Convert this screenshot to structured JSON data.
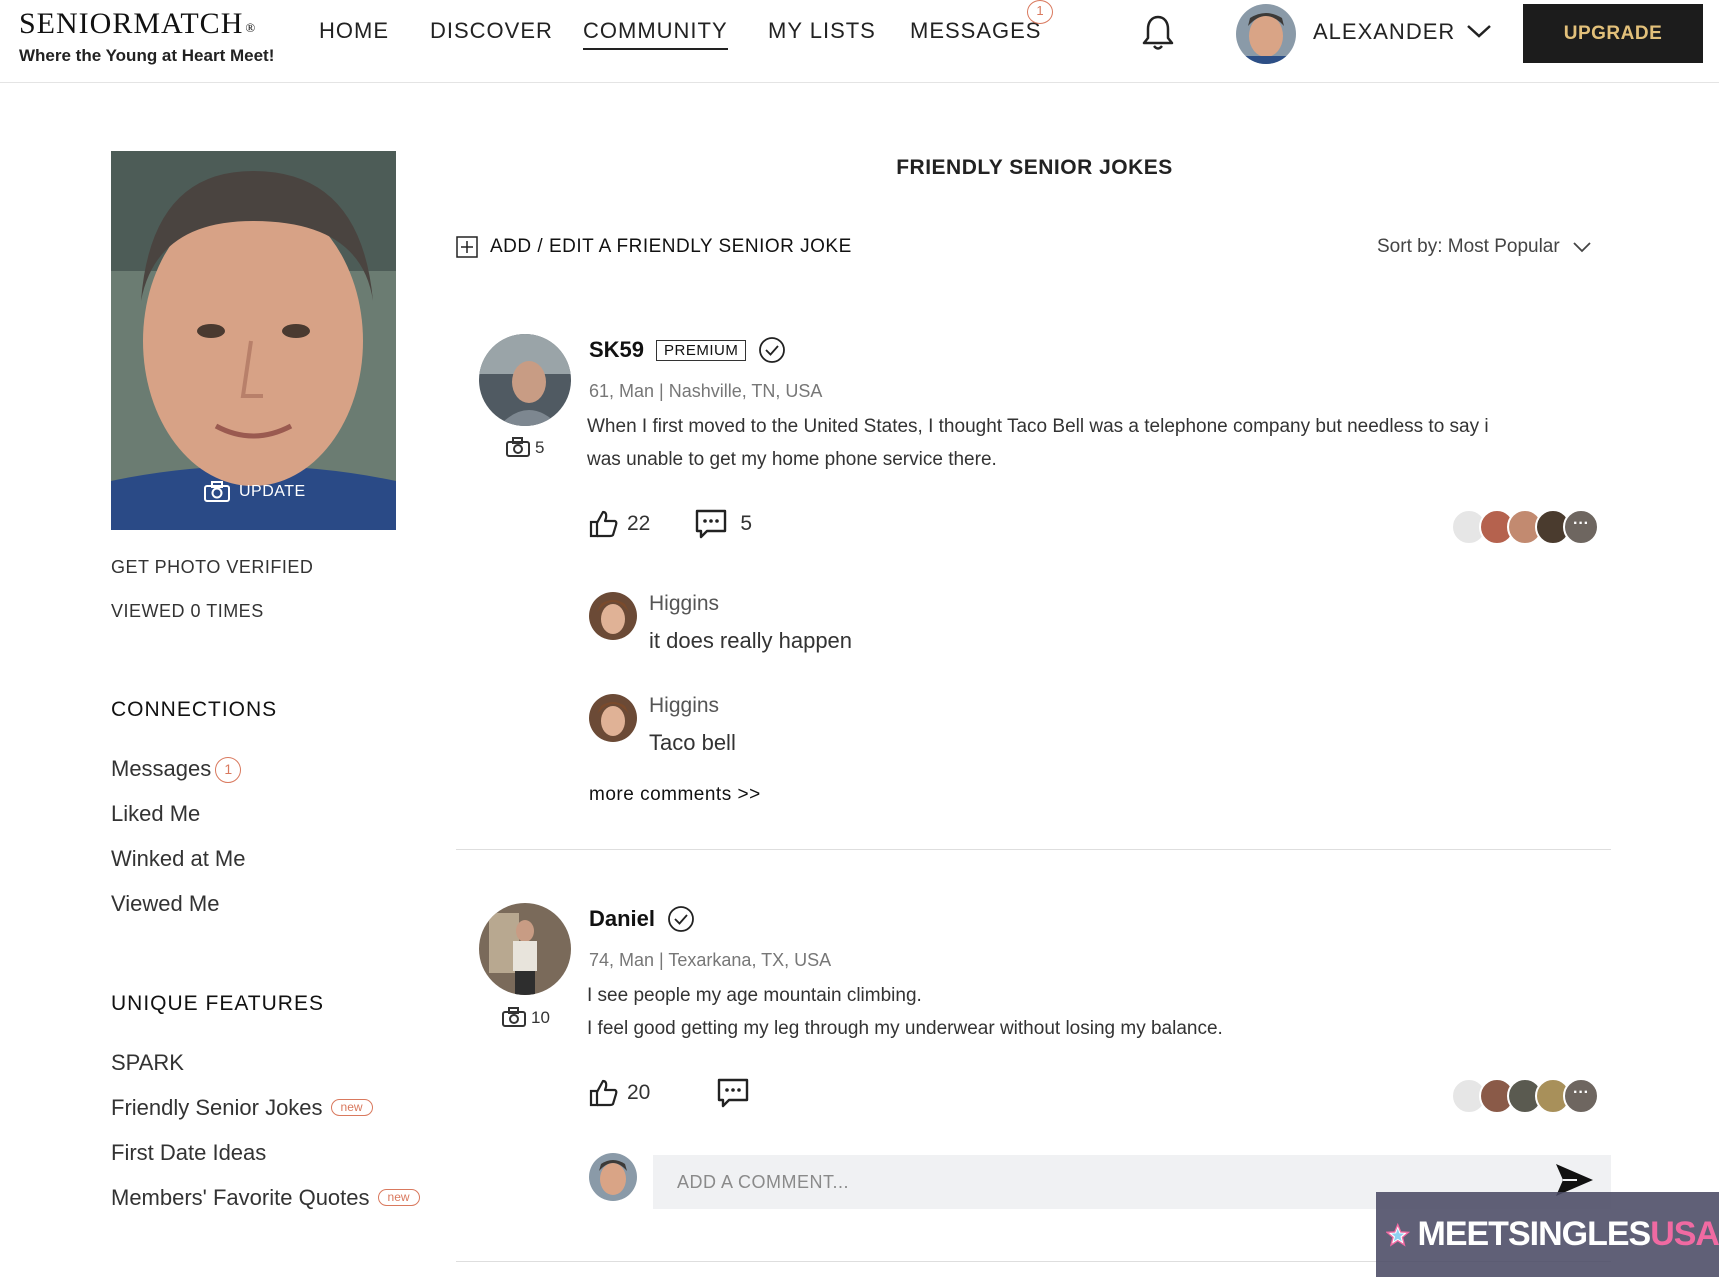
{
  "header": {
    "logo_title": "SENIORMATCH",
    "logo_mark": "®",
    "logo_tagline": "Where the Young at Heart Meet!",
    "nav": [
      "HOME",
      "DISCOVER",
      "COMMUNITY",
      "MY LISTS",
      "MESSAGES"
    ],
    "active_nav": "COMMUNITY",
    "messages_badge": "1",
    "user_name": "ALEXANDER",
    "upgrade_label": "UPGRADE",
    "icons": [
      "bell-icon",
      "chevron-down-icon"
    ]
  },
  "sidebar": {
    "photo_update_label": "UPDATE",
    "get_verified": "GET PHOTO VERIFIED",
    "viewed": "VIEWED 0 TIMES",
    "connections_heading": "CONNECTIONS",
    "connections": [
      {
        "label": "Messages",
        "badge": "1"
      },
      {
        "label": "Liked Me"
      },
      {
        "label": "Winked at Me"
      },
      {
        "label": "Viewed Me"
      }
    ],
    "features_heading": "UNIQUE FEATURES",
    "features": [
      {
        "label": "SPARK"
      },
      {
        "label": "Friendly Senior Jokes",
        "tag": "new"
      },
      {
        "label": "First Date Ideas"
      },
      {
        "label": "Members' Favorite Quotes",
        "tag": "new"
      }
    ]
  },
  "main": {
    "title": "FRIENDLY SENIOR JOKES",
    "add_label": "ADD / EDIT A FRIENDLY SENIOR JOKE",
    "sort_label": "Sort by: Most Popular",
    "posts": [
      {
        "name": "SK59",
        "badge": "PREMIUM",
        "verified": true,
        "photos": "5",
        "meta": "61, Man | Nashville, TN, USA",
        "text_lines": [
          "When I first moved to the United States, I thought Taco Bell was a telephone company but needless to say i",
          "was unable to get my home phone service there."
        ],
        "likes": "22",
        "comments_count": "5",
        "comments": [
          {
            "name": "Higgins",
            "text": "it does really happen"
          },
          {
            "name": "Higgins",
            "text": "Taco bell"
          }
        ],
        "more_comments": "more comments >>"
      },
      {
        "name": "Daniel",
        "verified": true,
        "photos": "10",
        "meta": "74, Man | Texarkana, TX, USA",
        "text_lines": [
          "I see people my age mountain climbing.",
          "I feel good getting my leg through my underwear without losing my balance."
        ],
        "likes": "20",
        "comment_placeholder": "ADD A COMMENT..."
      }
    ]
  },
  "watermark": {
    "text_main": "MEETSINGLES",
    "text_accent": "USA"
  },
  "colors": {
    "accent": "#d9795e",
    "upgrade_bg": "#1c1c1c",
    "upgrade_text": "#e2c07a"
  }
}
